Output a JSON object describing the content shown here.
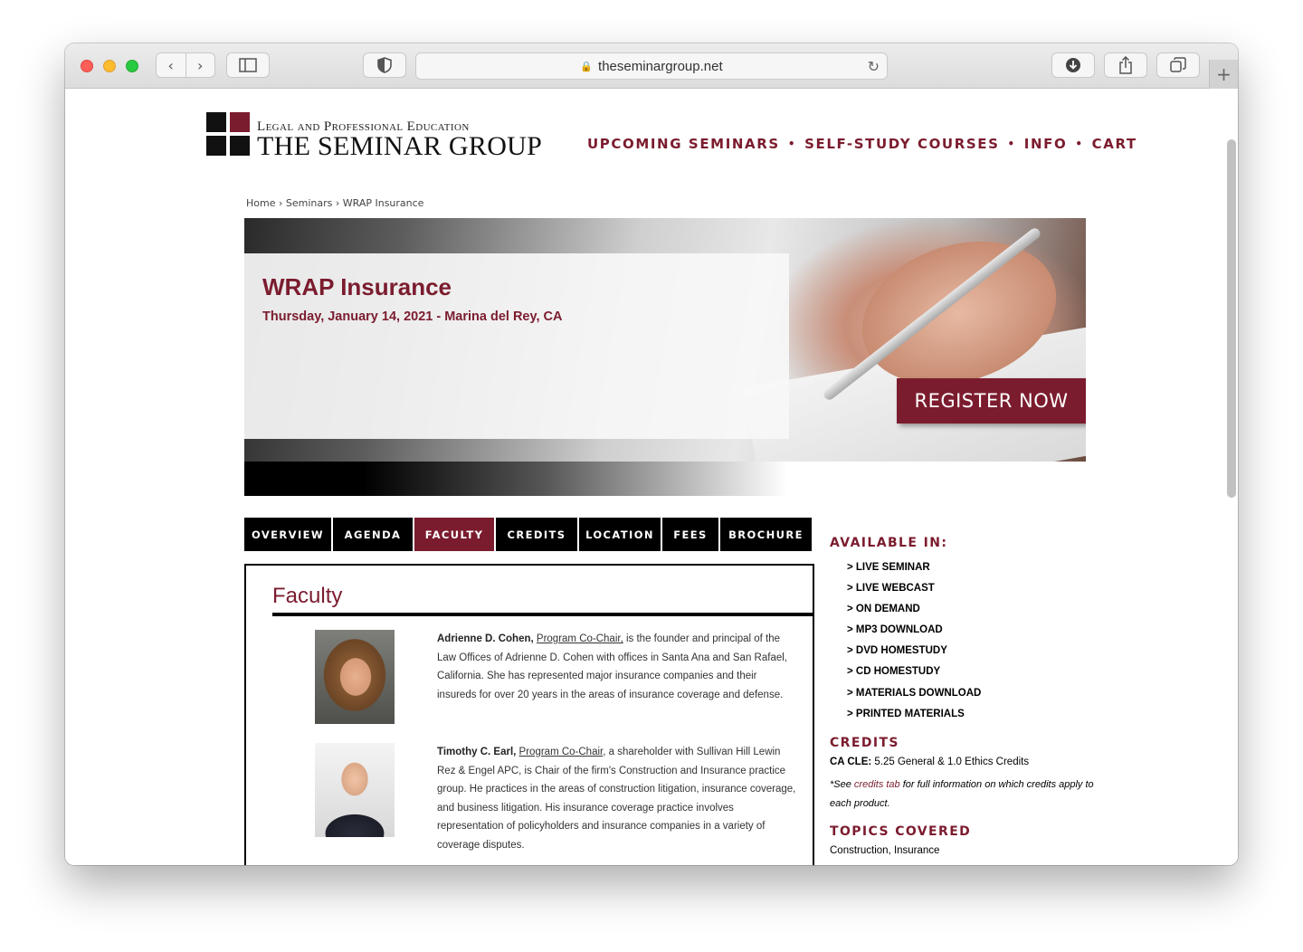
{
  "browser": {
    "url": "theseminargroup.net"
  },
  "site": {
    "logo_sub": "Legal and Professional Education",
    "logo_main": "THE SEMINAR GROUP",
    "nav": [
      "UPCOMING SEMINARS",
      "SELF-STUDY COURSES",
      "INFO",
      "CART"
    ],
    "nav_separator": "•"
  },
  "breadcrumb": "Home › Seminars › WRAP Insurance",
  "hero": {
    "title": "WRAP Insurance",
    "date_location": "Thursday, January 14, 2021 - Marina del Rey, CA",
    "register_label": "REGISTER NOW"
  },
  "tabs": [
    {
      "label": "OVERVIEW",
      "active": false
    },
    {
      "label": "AGENDA",
      "active": false
    },
    {
      "label": "FACULTY",
      "active": true
    },
    {
      "label": "CREDITS",
      "active": false
    },
    {
      "label": "LOCATION",
      "active": false
    },
    {
      "label": "FEES",
      "active": false
    },
    {
      "label": "BROCHURE",
      "active": false
    }
  ],
  "faculty": {
    "heading": "Faculty",
    "people": [
      {
        "name": "Adrienne D. Cohen,",
        "role": "Program Co-Chair,",
        "bio": " is the founder and principal of the Law Offices of Adrienne D. Cohen with offices in Santa Ana and San Rafael, California. She has represented major insurance companies and their insureds for over 20 years in the areas of insurance coverage and defense."
      },
      {
        "name": "Timothy C. Earl,",
        "role": "Program Co-Chair",
        "bio": ", a shareholder with Sullivan Hill Lewin Rez & Engel APC, is Chair of the firm's Construction and Insurance practice group. He practices in the areas of construction litigation, insurance coverage, and business litigation. His insurance coverage practice involves representation of policyholders and insurance companies in a variety of coverage disputes."
      }
    ]
  },
  "sidebar": {
    "available_heading": "AVAILABLE IN:",
    "available_items": [
      "> LIVE SEMINAR",
      "> LIVE WEBCAST",
      "> ON DEMAND",
      "> MP3 DOWNLOAD",
      "> DVD HOMESTUDY",
      "> CD HOMESTUDY",
      "> MATERIALS DOWNLOAD",
      "> PRINTED MATERIALS"
    ],
    "credits_heading": "CREDITS",
    "credits_label": "CA CLE:",
    "credits_value": " 5.25 General & 1.0 Ethics Credits",
    "credits_note_pre": "*See ",
    "credits_note_link": "credits tab",
    "credits_note_post": " for full information on which credits apply to each product.",
    "topics_heading": "TOPICS COVERED",
    "topics_value": "Construction, Insurance"
  },
  "colors": {
    "brand": "#7b1c2e",
    "tab_bg": "#000000"
  }
}
